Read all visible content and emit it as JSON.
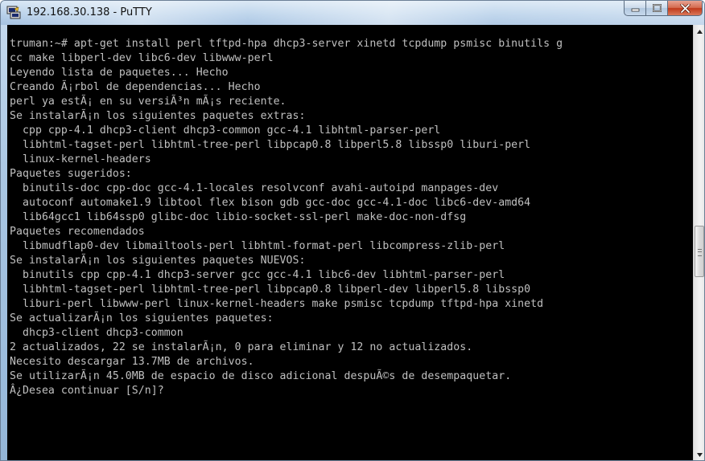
{
  "window": {
    "title": "192.168.30.138 - PuTTY",
    "icon": "putty-icon"
  },
  "caption_buttons": {
    "minimize_icon": "minimize-icon",
    "maximize_icon": "maximize-icon",
    "close_icon": "close-icon"
  },
  "terminal": {
    "background": "#000000",
    "foreground": "#c0c0c0",
    "lines": [
      "truman:~# apt-get install perl tftpd-hpa dhcp3-server xinetd tcpdump psmisc binutils g",
      "cc make libperl-dev libc6-dev libwww-perl",
      "Leyendo lista de paquetes... Hecho",
      "Creando Ã¡rbol de dependencias... Hecho",
      "perl ya estÃ¡ en su versiÃ³n mÃ¡s reciente.",
      "Se instalarÃ¡n los siguientes paquetes extras:",
      "  cpp cpp-4.1 dhcp3-client dhcp3-common gcc-4.1 libhtml-parser-perl",
      "  libhtml-tagset-perl libhtml-tree-perl libpcap0.8 libperl5.8 libssp0 liburi-perl",
      "  linux-kernel-headers",
      "Paquetes sugeridos:",
      "  binutils-doc cpp-doc gcc-4.1-locales resolvconf avahi-autoipd manpages-dev",
      "  autoconf automake1.9 libtool flex bison gdb gcc-doc gcc-4.1-doc libc6-dev-amd64",
      "  lib64gcc1 lib64ssp0 glibc-doc libio-socket-ssl-perl make-doc-non-dfsg",
      "Paquetes recomendados",
      "  libmudflap0-dev libmailtools-perl libhtml-format-perl libcompress-zlib-perl",
      "Se instalarÃ¡n los siguientes paquetes NUEVOS:",
      "  binutils cpp cpp-4.1 dhcp3-server gcc gcc-4.1 libc6-dev libhtml-parser-perl",
      "  libhtml-tagset-perl libhtml-tree-perl libpcap0.8 libperl-dev libperl5.8 libssp0",
      "  liburi-perl libwww-perl linux-kernel-headers make psmisc tcpdump tftpd-hpa xinetd",
      "Se actualizarÃ¡n los siguientes paquetes:",
      "  dhcp3-client dhcp3-common",
      "2 actualizados, 22 se instalarÃ¡n, 0 para eliminar y 12 no actualizados.",
      "Necesito descargar 13.7MB de archivos.",
      "Se utilizarÃ¡n 45.0MB de espacio de disco adicional despuÃ©s de desempaquetar.",
      "Â¿Desea continuar [S/n]?"
    ]
  },
  "scrollbar": {
    "up_icon": "scroll-up-arrow-icon",
    "down_icon": "scroll-down-arrow-icon"
  }
}
